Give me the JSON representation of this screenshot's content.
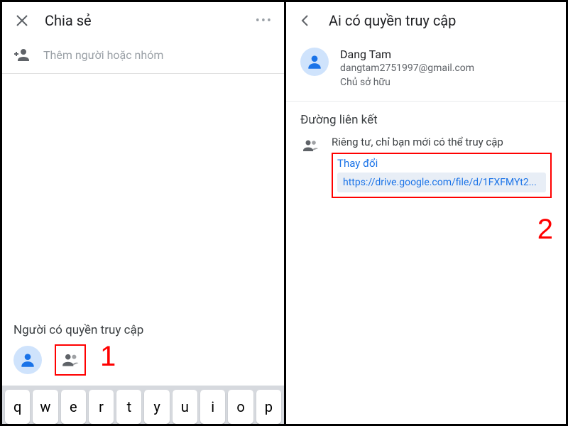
{
  "left": {
    "title": "Chia sẻ",
    "add_placeholder": "Thêm người hoặc nhóm",
    "access_heading": "Người có quyền truy cập",
    "keyboard_row": [
      "q",
      "w",
      "e",
      "r",
      "t",
      "y",
      "u",
      "i",
      "o",
      "p"
    ]
  },
  "right": {
    "title": "Ai có quyền truy cập",
    "owner": {
      "name": "Dang Tam",
      "email": "dangtam2751997@gmail.com",
      "role": "Chủ sở hữu"
    },
    "link_heading": "Đường liên kết",
    "privacy_text": "Riêng tư, chỉ bạn mới có thể truy cập",
    "change_label": "Thay đổi",
    "url": "https://drive.google.com/file/d/1FXFMYt2..."
  },
  "annotations": {
    "one": "1",
    "two": "2"
  }
}
